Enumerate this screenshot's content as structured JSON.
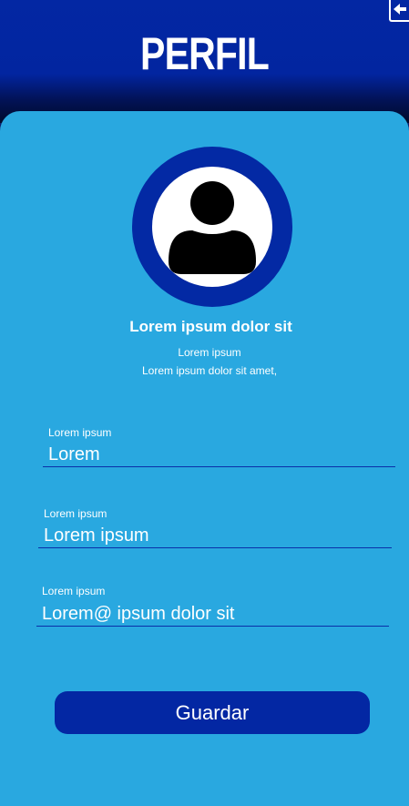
{
  "header": {
    "title": "PERFIL",
    "exit_icon": "exit-icon"
  },
  "profile": {
    "avatar_icon": "user-icon",
    "name": "Lorem ipsum dolor sit",
    "line1": "Lorem ipsum",
    "line2": "Lorem ipsum dolor sit amet,"
  },
  "fields": [
    {
      "label": "Lorem ipsum",
      "value": "Lorem"
    },
    {
      "label": "Lorem ipsum",
      "value": "Lorem ipsum"
    },
    {
      "label": "Lorem ipsum",
      "value": "Lorem@ ipsum dolor sit"
    }
  ],
  "actions": {
    "save_label": "Guardar"
  },
  "colors": {
    "primary": "#0327a3",
    "card": "#29a8e0",
    "text": "#ffffff"
  }
}
